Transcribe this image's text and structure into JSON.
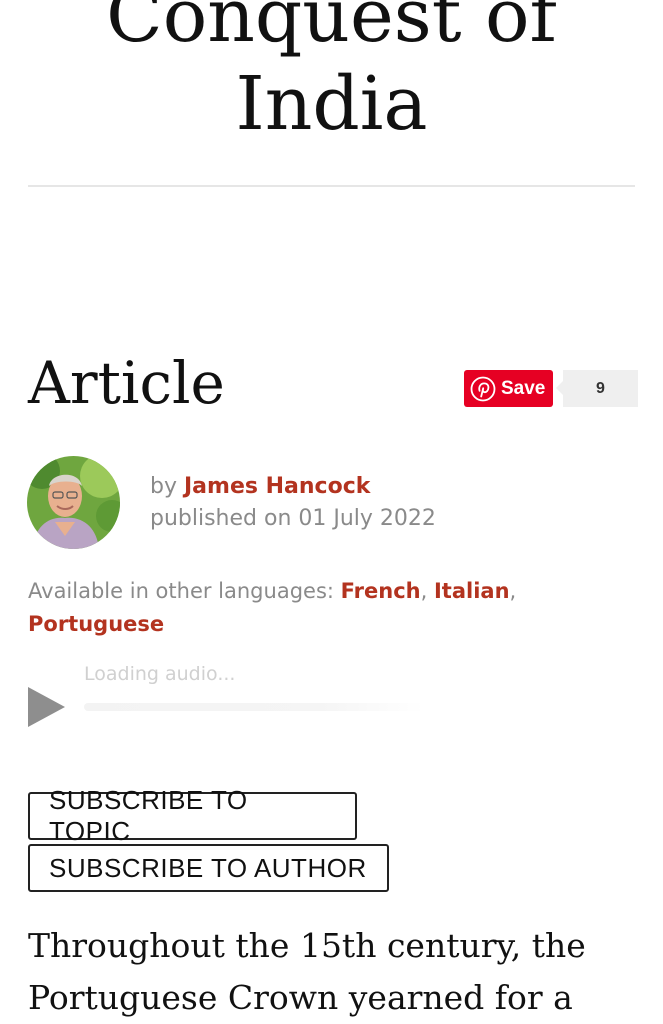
{
  "page": {
    "title": "Conquest of India"
  },
  "article": {
    "heading": "Article",
    "pinterest": {
      "save_label": "Save",
      "count": "9",
      "brand_color": "#e60023"
    },
    "byline": {
      "by_prefix": "by",
      "author": "James Hancock",
      "published": "published on 01 July 2022"
    },
    "languages": {
      "prefix": "Available in other languages:",
      "items": [
        "French",
        "Italian",
        "Portuguese"
      ],
      "sep1": ",",
      "sep2": ","
    },
    "audio": {
      "status": "Loading audio..."
    },
    "subscribe": {
      "topic_label": "SUBSCRIBE TO TOPIC",
      "author_label": "SUBSCRIBE TO AUTHOR"
    },
    "intro_text": "Throughout the 15th century, the Portuguese Crown yearned for a"
  },
  "colors": {
    "link": "#b3331f",
    "meta_text": "#8a8a8a",
    "rule": "#e6e6e6"
  }
}
